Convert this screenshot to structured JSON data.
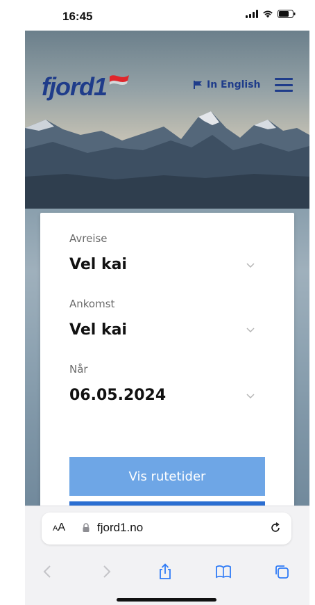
{
  "status_bar": {
    "time": "16:45"
  },
  "header": {
    "logo": "fjord1",
    "language_link": "In English"
  },
  "form": {
    "departure": {
      "label": "Avreise",
      "value": "Vel kai"
    },
    "arrival": {
      "label": "Ankomst",
      "value": "Vel kai"
    },
    "date": {
      "label": "Når",
      "value": "06.05.2024"
    },
    "submit_label": "Vis rutetider"
  },
  "browser": {
    "text_size_label": "AA",
    "url": "fjord1.no"
  },
  "colors": {
    "brand_blue": "#1f3c8a",
    "brand_red": "#e0262b",
    "button_blue": "#6ea6e6",
    "strip_blue": "#2b6ed1"
  },
  "icons": [
    "signal-icon",
    "wifi-icon",
    "battery-icon",
    "flag-icon",
    "menu-icon",
    "chevron-down-icon",
    "lock-icon",
    "reload-icon",
    "back-icon",
    "forward-icon",
    "share-icon",
    "bookmarks-icon",
    "tabs-icon"
  ]
}
